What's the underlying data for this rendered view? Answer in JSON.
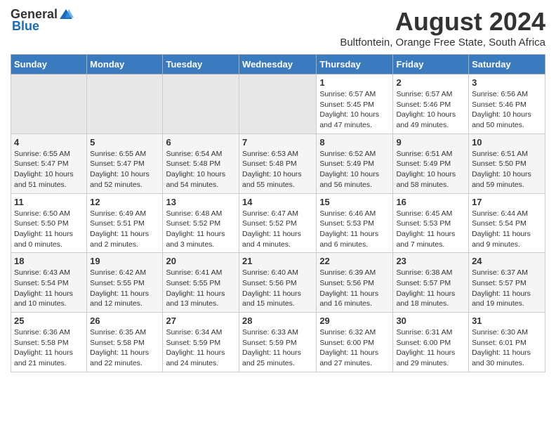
{
  "header": {
    "logo_general": "General",
    "logo_blue": "Blue",
    "main_title": "August 2024",
    "subtitle": "Bultfontein, Orange Free State, South Africa"
  },
  "days_of_week": [
    "Sunday",
    "Monday",
    "Tuesday",
    "Wednesday",
    "Thursday",
    "Friday",
    "Saturday"
  ],
  "weeks": [
    [
      {
        "day": "",
        "info": ""
      },
      {
        "day": "",
        "info": ""
      },
      {
        "day": "",
        "info": ""
      },
      {
        "day": "",
        "info": ""
      },
      {
        "day": "1",
        "info": "Sunrise: 6:57 AM\nSunset: 5:45 PM\nDaylight: 10 hours\nand 47 minutes."
      },
      {
        "day": "2",
        "info": "Sunrise: 6:57 AM\nSunset: 5:46 PM\nDaylight: 10 hours\nand 49 minutes."
      },
      {
        "day": "3",
        "info": "Sunrise: 6:56 AM\nSunset: 5:46 PM\nDaylight: 10 hours\nand 50 minutes."
      }
    ],
    [
      {
        "day": "4",
        "info": "Sunrise: 6:55 AM\nSunset: 5:47 PM\nDaylight: 10 hours\nand 51 minutes."
      },
      {
        "day": "5",
        "info": "Sunrise: 6:55 AM\nSunset: 5:47 PM\nDaylight: 10 hours\nand 52 minutes."
      },
      {
        "day": "6",
        "info": "Sunrise: 6:54 AM\nSunset: 5:48 PM\nDaylight: 10 hours\nand 54 minutes."
      },
      {
        "day": "7",
        "info": "Sunrise: 6:53 AM\nSunset: 5:48 PM\nDaylight: 10 hours\nand 55 minutes."
      },
      {
        "day": "8",
        "info": "Sunrise: 6:52 AM\nSunset: 5:49 PM\nDaylight: 10 hours\nand 56 minutes."
      },
      {
        "day": "9",
        "info": "Sunrise: 6:51 AM\nSunset: 5:49 PM\nDaylight: 10 hours\nand 58 minutes."
      },
      {
        "day": "10",
        "info": "Sunrise: 6:51 AM\nSunset: 5:50 PM\nDaylight: 10 hours\nand 59 minutes."
      }
    ],
    [
      {
        "day": "11",
        "info": "Sunrise: 6:50 AM\nSunset: 5:50 PM\nDaylight: 11 hours\nand 0 minutes."
      },
      {
        "day": "12",
        "info": "Sunrise: 6:49 AM\nSunset: 5:51 PM\nDaylight: 11 hours\nand 2 minutes."
      },
      {
        "day": "13",
        "info": "Sunrise: 6:48 AM\nSunset: 5:52 PM\nDaylight: 11 hours\nand 3 minutes."
      },
      {
        "day": "14",
        "info": "Sunrise: 6:47 AM\nSunset: 5:52 PM\nDaylight: 11 hours\nand 4 minutes."
      },
      {
        "day": "15",
        "info": "Sunrise: 6:46 AM\nSunset: 5:53 PM\nDaylight: 11 hours\nand 6 minutes."
      },
      {
        "day": "16",
        "info": "Sunrise: 6:45 AM\nSunset: 5:53 PM\nDaylight: 11 hours\nand 7 minutes."
      },
      {
        "day": "17",
        "info": "Sunrise: 6:44 AM\nSunset: 5:54 PM\nDaylight: 11 hours\nand 9 minutes."
      }
    ],
    [
      {
        "day": "18",
        "info": "Sunrise: 6:43 AM\nSunset: 5:54 PM\nDaylight: 11 hours\nand 10 minutes."
      },
      {
        "day": "19",
        "info": "Sunrise: 6:42 AM\nSunset: 5:55 PM\nDaylight: 11 hours\nand 12 minutes."
      },
      {
        "day": "20",
        "info": "Sunrise: 6:41 AM\nSunset: 5:55 PM\nDaylight: 11 hours\nand 13 minutes."
      },
      {
        "day": "21",
        "info": "Sunrise: 6:40 AM\nSunset: 5:56 PM\nDaylight: 11 hours\nand 15 minutes."
      },
      {
        "day": "22",
        "info": "Sunrise: 6:39 AM\nSunset: 5:56 PM\nDaylight: 11 hours\nand 16 minutes."
      },
      {
        "day": "23",
        "info": "Sunrise: 6:38 AM\nSunset: 5:57 PM\nDaylight: 11 hours\nand 18 minutes."
      },
      {
        "day": "24",
        "info": "Sunrise: 6:37 AM\nSunset: 5:57 PM\nDaylight: 11 hours\nand 19 minutes."
      }
    ],
    [
      {
        "day": "25",
        "info": "Sunrise: 6:36 AM\nSunset: 5:58 PM\nDaylight: 11 hours\nand 21 minutes."
      },
      {
        "day": "26",
        "info": "Sunrise: 6:35 AM\nSunset: 5:58 PM\nDaylight: 11 hours\nand 22 minutes."
      },
      {
        "day": "27",
        "info": "Sunrise: 6:34 AM\nSunset: 5:59 PM\nDaylight: 11 hours\nand 24 minutes."
      },
      {
        "day": "28",
        "info": "Sunrise: 6:33 AM\nSunset: 5:59 PM\nDaylight: 11 hours\nand 25 minutes."
      },
      {
        "day": "29",
        "info": "Sunrise: 6:32 AM\nSunset: 6:00 PM\nDaylight: 11 hours\nand 27 minutes."
      },
      {
        "day": "30",
        "info": "Sunrise: 6:31 AM\nSunset: 6:00 PM\nDaylight: 11 hours\nand 29 minutes."
      },
      {
        "day": "31",
        "info": "Sunrise: 6:30 AM\nSunset: 6:01 PM\nDaylight: 11 hours\nand 30 minutes."
      }
    ]
  ]
}
